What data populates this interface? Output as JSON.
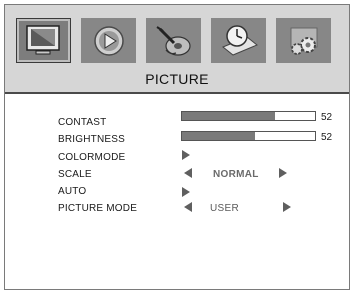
{
  "header": {
    "title": "PICTURE",
    "tabs": [
      {
        "name": "picture",
        "icon": "monitor-icon",
        "active": true
      },
      {
        "name": "play",
        "icon": "play-icon",
        "active": false
      },
      {
        "name": "audio",
        "icon": "guitar-icon",
        "active": false
      },
      {
        "name": "time",
        "icon": "clock-icon",
        "active": false
      },
      {
        "name": "setup",
        "icon": "gears-icon",
        "active": false
      }
    ]
  },
  "settings": {
    "contrast": {
      "label": "CONTAST",
      "value": "52",
      "level": 0.7
    },
    "brightness": {
      "label": "BRIGHTNESS",
      "value": "52",
      "level": 0.55
    },
    "colormode": {
      "label": "COLORMODE"
    },
    "scale": {
      "label": "SCALE",
      "value": "NORMAL"
    },
    "auto": {
      "label": "AUTO"
    },
    "picture_mode": {
      "label": "PICTURE MODE",
      "value": "USER"
    }
  },
  "colors": {
    "header_bg": "#d6d6d6",
    "tab_bg": "#878787",
    "bar_fill": "#7a7a7a"
  }
}
